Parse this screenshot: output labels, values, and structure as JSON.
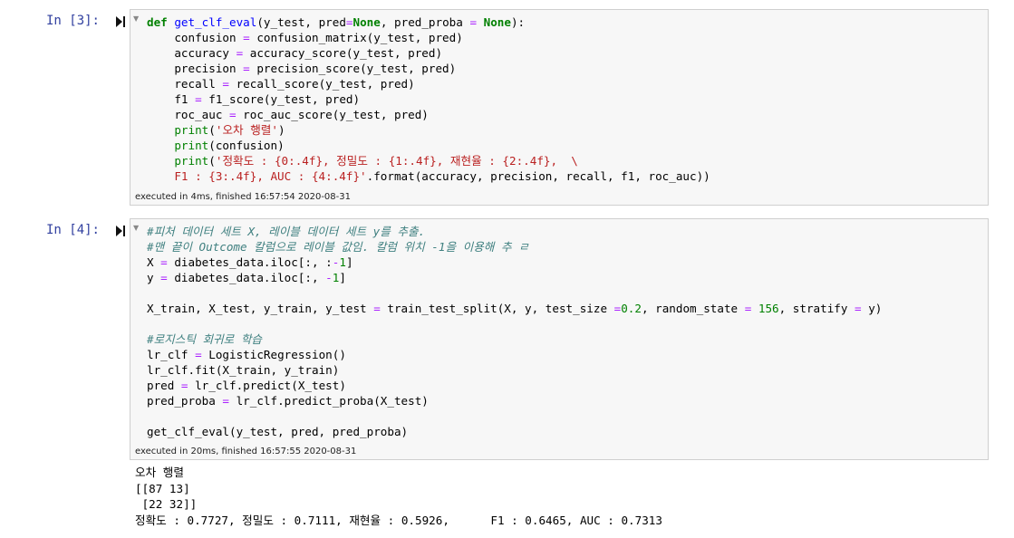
{
  "cells": [
    {
      "prompt": "In [3]:",
      "exec_info": "executed in 4ms, finished 16:57:54 2020-08-31",
      "code_lines": [
        [
          [
            "kw",
            "def "
          ],
          [
            "fn",
            "get_clf_eval"
          ],
          [
            "",
            "(y_test, pred"
          ],
          [
            "op",
            "="
          ],
          [
            "none",
            "None"
          ],
          [
            "",
            ", pred_proba "
          ],
          [
            "op",
            "="
          ],
          [
            "none",
            " None"
          ],
          [
            "",
            "):"
          ]
        ],
        [
          [
            "",
            "    confusion "
          ],
          [
            "op",
            "="
          ],
          [
            "",
            " confusion_matrix(y_test, pred)"
          ]
        ],
        [
          [
            "",
            "    accuracy "
          ],
          [
            "op",
            "="
          ],
          [
            "",
            " accuracy_score(y_test, pred)"
          ]
        ],
        [
          [
            "",
            "    precision "
          ],
          [
            "op",
            "="
          ],
          [
            "",
            " precision_score(y_test, pred)"
          ]
        ],
        [
          [
            "",
            "    recall "
          ],
          [
            "op",
            "="
          ],
          [
            "",
            " recall_score(y_test, pred)"
          ]
        ],
        [
          [
            "",
            "    f1 "
          ],
          [
            "op",
            "="
          ],
          [
            "",
            " f1_score(y_test, pred)"
          ]
        ],
        [
          [
            "",
            "    roc_auc "
          ],
          [
            "op",
            "="
          ],
          [
            "",
            " roc_auc_score(y_test, pred)"
          ]
        ],
        [
          [
            "",
            "    "
          ],
          [
            "bi",
            "print"
          ],
          [
            "",
            "("
          ],
          [
            "str",
            "'오차 행렬'"
          ],
          [
            "",
            ")"
          ]
        ],
        [
          [
            "",
            "    "
          ],
          [
            "bi",
            "print"
          ],
          [
            "",
            "(confusion)"
          ]
        ],
        [
          [
            "",
            "    "
          ],
          [
            "bi",
            "print"
          ],
          [
            "",
            "("
          ],
          [
            "str",
            "'정확도 : {0:.4f}, 정밀도 : {1:.4f}, 재현율 : {2:.4f},  \\"
          ]
        ],
        [
          [
            "str",
            "    F1 : {3:.4f}, AUC : {4:.4f}'"
          ],
          [
            "",
            ".format(accuracy, precision, recall, f1, roc_auc))"
          ]
        ]
      ]
    },
    {
      "prompt": "In [4]:",
      "exec_info": "executed in 20ms, finished 16:57:55 2020-08-31",
      "code_lines": [
        [
          [
            "cm",
            "#피처 데이터 세트 X, 레이블 데이터 세트 y를 추출."
          ]
        ],
        [
          [
            "cm",
            "#맨 끝이 Outcome 칼럼으로 레이블 값임. 칼럼 위치 -1을 이용해 추 ㄹ"
          ]
        ],
        [
          [
            "",
            "X "
          ],
          [
            "op",
            "="
          ],
          [
            "",
            " diabetes_data.iloc[:, :"
          ],
          [
            "op",
            "-"
          ],
          [
            "num",
            "1"
          ],
          [
            "",
            "]"
          ]
        ],
        [
          [
            "",
            "y "
          ],
          [
            "op",
            "="
          ],
          [
            "",
            " diabetes_data.iloc[:, "
          ],
          [
            "op",
            "-"
          ],
          [
            "num",
            "1"
          ],
          [
            "",
            "]"
          ]
        ],
        [
          [
            "",
            ""
          ]
        ],
        [
          [
            "",
            "X_train, X_test, y_train, y_test "
          ],
          [
            "op",
            "="
          ],
          [
            "",
            " train_test_split(X, y, test_size "
          ],
          [
            "op",
            "="
          ],
          [
            "num",
            "0.2"
          ],
          [
            "",
            ", random_state "
          ],
          [
            "op",
            "="
          ],
          [
            "num",
            " 156"
          ],
          [
            "",
            ", stratify "
          ],
          [
            "op",
            "="
          ],
          [
            "",
            " y)"
          ]
        ],
        [
          [
            "",
            ""
          ]
        ],
        [
          [
            "cm",
            "#로지스틱 회귀로 학습"
          ]
        ],
        [
          [
            "",
            "lr_clf "
          ],
          [
            "op",
            "="
          ],
          [
            "",
            " LogisticRegression()"
          ]
        ],
        [
          [
            "",
            "lr_clf.fit(X_train, y_train)"
          ]
        ],
        [
          [
            "",
            "pred "
          ],
          [
            "op",
            "="
          ],
          [
            "",
            " lr_clf.predict(X_test)"
          ]
        ],
        [
          [
            "",
            "pred_proba "
          ],
          [
            "op",
            "="
          ],
          [
            "",
            " lr_clf.predict_proba(X_test)"
          ]
        ],
        [
          [
            "",
            ""
          ]
        ],
        [
          [
            "",
            "get_clf_eval(y_test, pred, pred_proba)"
          ]
        ]
      ]
    }
  ],
  "output_lines": [
    "오차 행렬",
    "[[87 13]",
    " [22 32]]",
    "정확도 : 0.7727, 정밀도 : 0.7111, 재현율 : 0.5926,      F1 : 0.6465, AUC : 0.7313"
  ],
  "icons": {
    "run": "run-cell-icon",
    "collapse": "collapse-caret-icon"
  },
  "colors": {
    "prompt": "#303f9f",
    "keyword": "#008000",
    "function": "#0000ff",
    "string": "#ba2121",
    "operator": "#aa22ff",
    "comment": "#408080",
    "cell_bg": "#f7f7f7",
    "border": "#cfcfcf"
  }
}
